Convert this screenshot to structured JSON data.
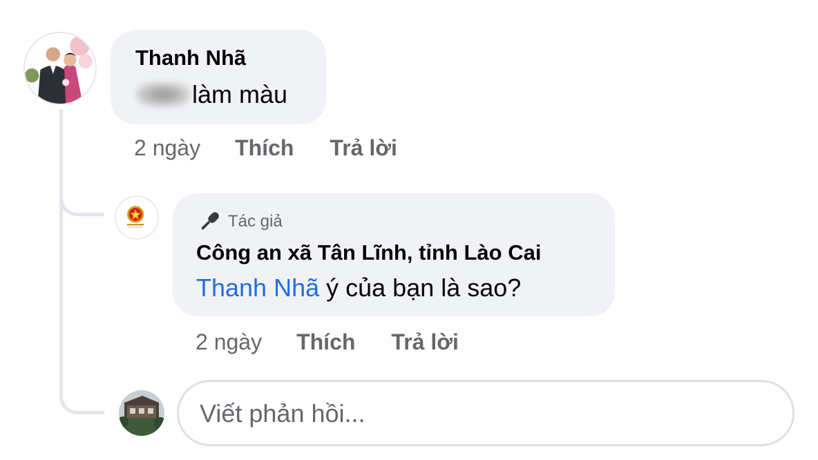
{
  "comment": {
    "author": "Thanh Nhã",
    "text": "làm màu",
    "time": "2 ngày",
    "like_label": "Thích",
    "reply_label": "Trả lời"
  },
  "reply": {
    "badge_label": "Tác giả",
    "author": "Công an xã Tân Lĩnh, tỉnh Lào Cai",
    "mention": "Thanh Nhã",
    "text": " ý của bạn là sao?",
    "time": "2 ngày",
    "like_label": "Thích",
    "reply_label": "Trả lời"
  },
  "compose": {
    "placeholder": "Viết phản hồi..."
  },
  "icons": {
    "author_badge": "microphone-icon",
    "author_avatar": "police-emblem-icon"
  },
  "colors": {
    "bubble": "#f0f2f5",
    "mention": "#216fdb",
    "secondary_text": "#65676b"
  }
}
